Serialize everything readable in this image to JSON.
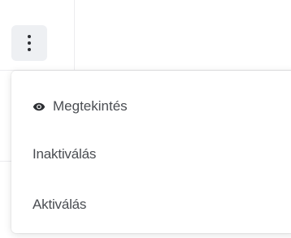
{
  "trigger": {
    "icon": "more-vertical-icon"
  },
  "menu": {
    "items": [
      {
        "label": "Megtekintés",
        "icon": "eye-icon"
      },
      {
        "label": "Inaktiválás"
      },
      {
        "label": "Aktiválás"
      }
    ]
  },
  "colors": {
    "trigger_bg": "#eef0f3",
    "menu_text": "#4a4d52",
    "icon_color": "#2d2f33"
  }
}
